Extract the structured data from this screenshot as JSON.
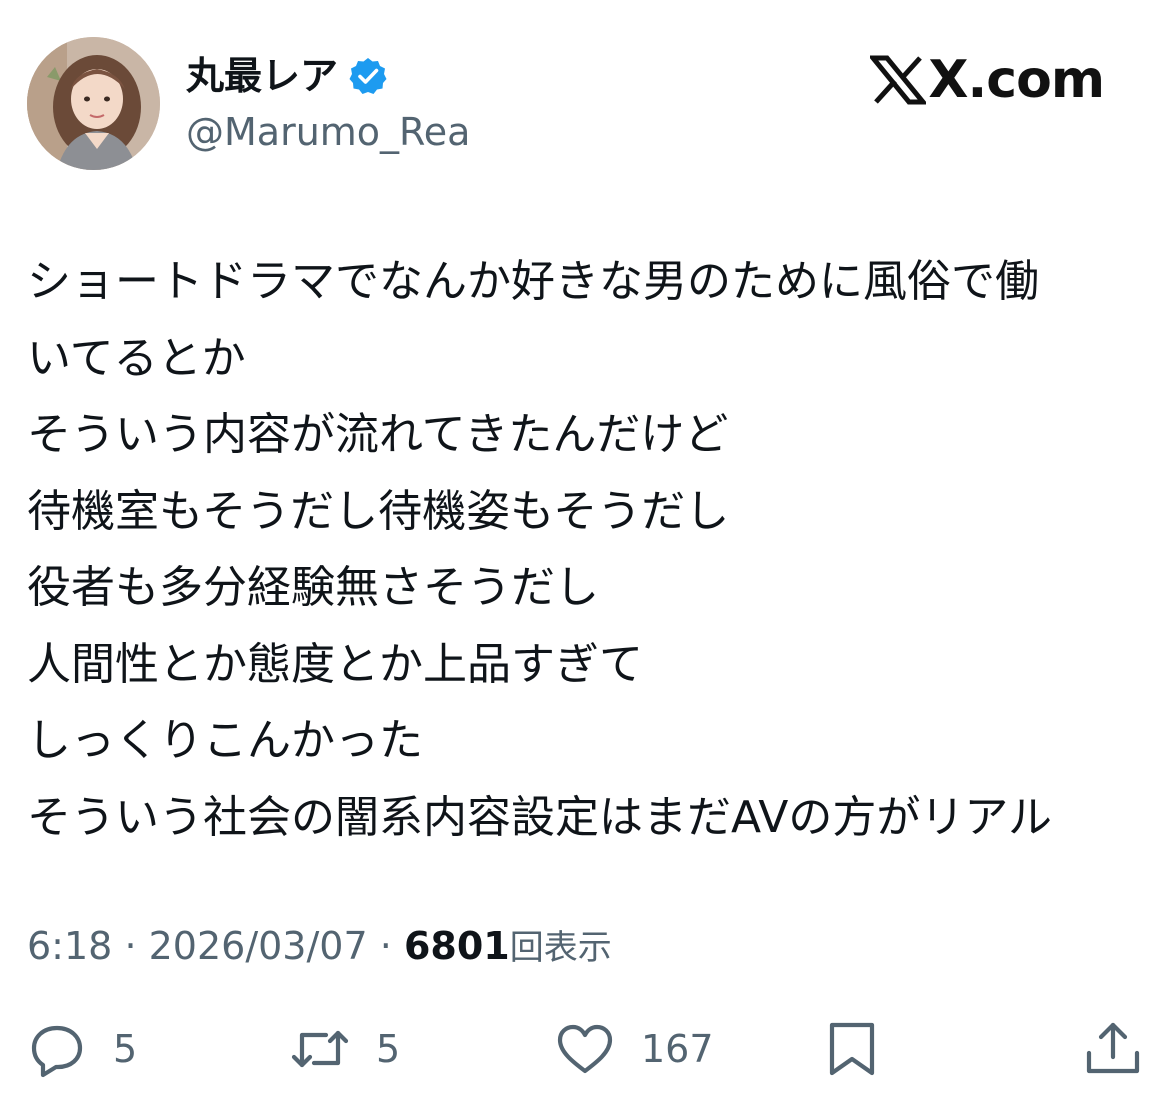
{
  "header": {
    "display_name": "丸最レア",
    "handle": "@Marumo_Rea",
    "verified_icon": "verified-badge-icon",
    "brand": "X.com",
    "brand_logo_icon": "x-logo-icon"
  },
  "post": {
    "lines": [
      "ショートドラマでなんか好きな男のために風俗で働",
      "いてるとか",
      "そういう内容が流れてきたんだけど",
      "待機室もそうだし待機姿もそうだし",
      "役者も多分経験無さそうだし",
      "人間性とか態度とか上品すぎて",
      "しっくりこんかった",
      "そういう社会の闇系内容設定はまだAVの方がリアル"
    ]
  },
  "meta": {
    "time": "6:18",
    "separator": "·",
    "date": "2026/03/07",
    "views_count": "6801",
    "views_label": "回表示"
  },
  "actions": {
    "reply": {
      "icon": "reply-icon",
      "count": "5"
    },
    "repost": {
      "icon": "repost-icon",
      "count": "5"
    },
    "like": {
      "icon": "heart-icon",
      "count": "167"
    },
    "bookmark": {
      "icon": "bookmark-icon"
    },
    "share": {
      "icon": "share-icon"
    }
  },
  "colors": {
    "text": "#0f1419",
    "secondary": "#536471",
    "verified": "#1d9bf0",
    "background": "#ffffff"
  }
}
